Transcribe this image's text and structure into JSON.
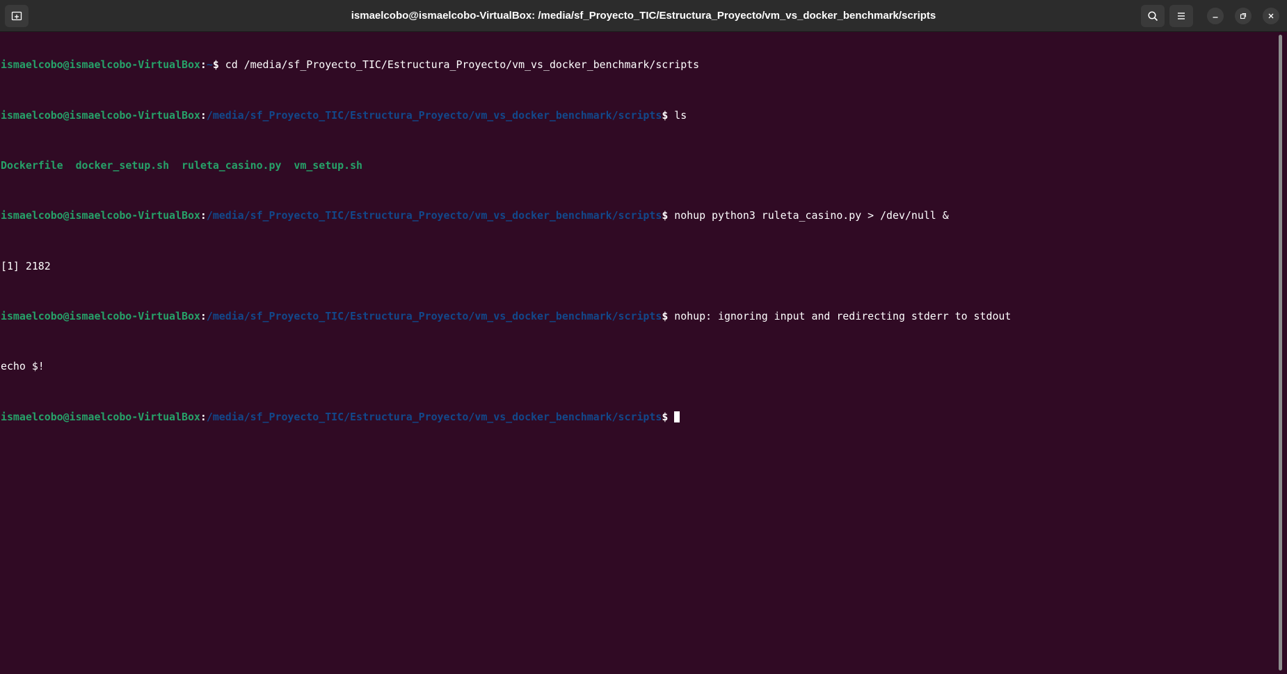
{
  "window": {
    "title": "ismaelcobo@ismaelcobo-VirtualBox: /media/sf_Proyecto_TIC/Estructura_Proyecto/vm_vs_docker_benchmark/scripts"
  },
  "icons": {
    "new_tab": "new-tab-icon",
    "search": "search-icon",
    "menu": "hamburger-menu-icon",
    "minimize": "minimize-icon",
    "maximize": "restore-icon",
    "close": "close-icon"
  },
  "colors": {
    "background": "#300a24",
    "user_host": "#26a269",
    "path": "#12488b",
    "text": "#ffffff"
  },
  "terminal": {
    "prompt_user": "ismaelcobo@ismaelcobo-VirtualBox",
    "prompt_colon": ":",
    "prompt_home": "~",
    "prompt_path": "/media/sf_Proyecto_TIC/Estructura_Proyecto/vm_vs_docker_benchmark/scripts",
    "prompt_dollar": "$",
    "cmd1": " cd /media/sf_Proyecto_TIC/Estructura_Proyecto/vm_vs_docker_benchmark/scripts",
    "cmd2": " ls",
    "files": [
      "Dockerfile",
      "docker_setup.sh",
      "ruleta_casino.py",
      "vm_setup.sh"
    ],
    "cmd3": " nohup python3 ruleta_casino.py > /dev/null &",
    "job_output": "[1] 2182",
    "cmd4": " nohup: ignoring input and redirecting stderr to stdout",
    "cmd4_cont": "echo $!",
    "cmd5": " "
  }
}
